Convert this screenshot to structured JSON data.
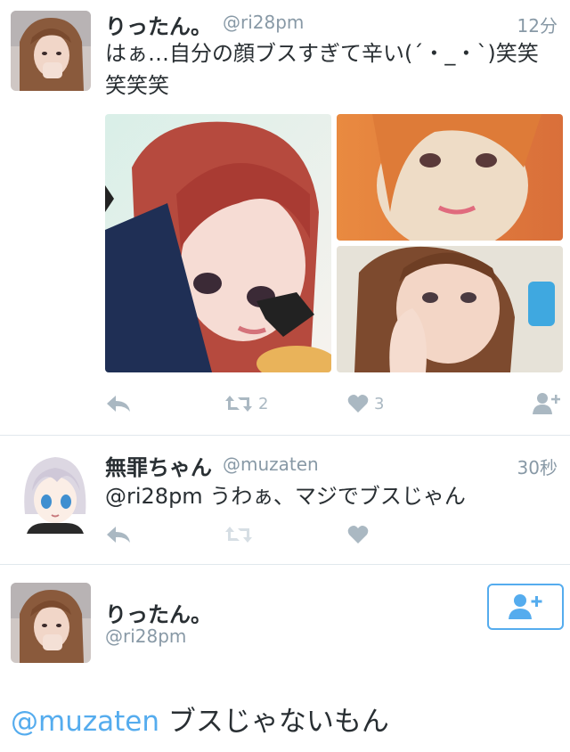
{
  "tweet1": {
    "name": "りったん。",
    "handle": "@ri28pm",
    "time": "12分",
    "text_line1": "はぁ…自分の顔ブスすぎて辛い(´・_・`)笑笑",
    "text_line2": "笑笑笑",
    "retweet_count": "2",
    "like_count": "3"
  },
  "tweet2": {
    "name": "無罪ちゃん",
    "handle": "@muzaten",
    "time": "30秒",
    "mention": "@ri28pm",
    "text": "うわぁ、マジでブスじゃん"
  },
  "tweet3": {
    "name": "りったん。",
    "handle": "@ri28pm",
    "mention": "@muzaten",
    "text": "ブスじゃないもん"
  },
  "icons": {
    "reply": "reply-icon",
    "retweet": "retweet-icon",
    "like": "heart-icon",
    "follow": "add-user-icon"
  },
  "colors": {
    "accent": "#55acee",
    "muted": "#8899a6",
    "action": "#aab8c2"
  }
}
